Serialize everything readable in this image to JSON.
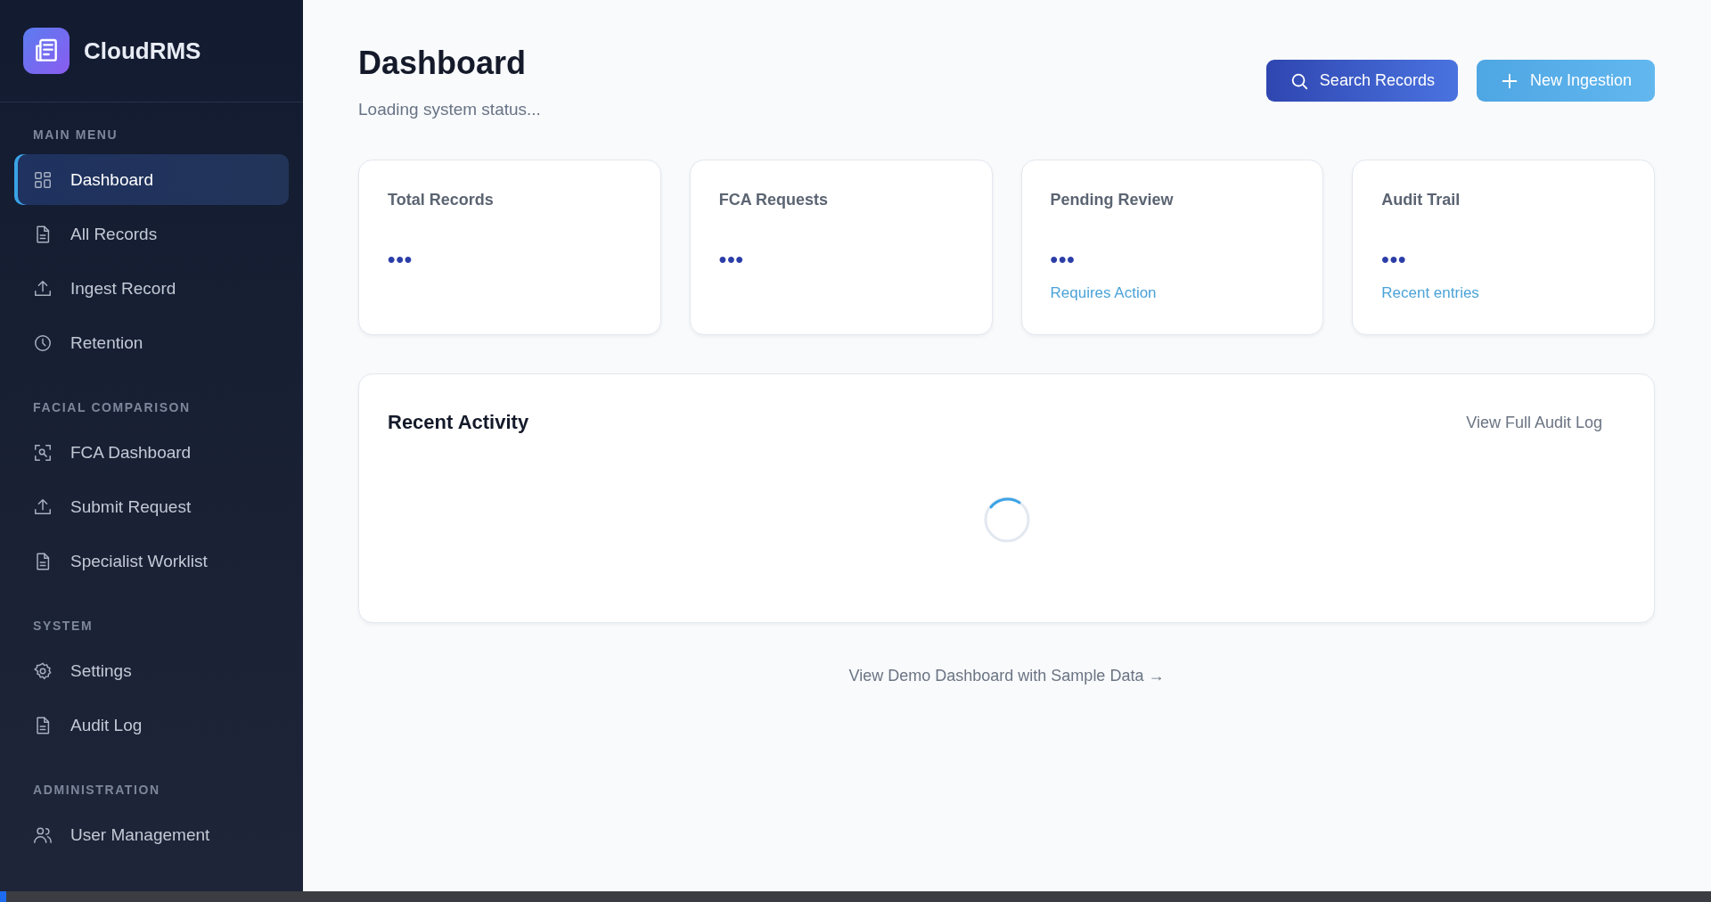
{
  "brand": {
    "name": "CloudRMS"
  },
  "sidebar": {
    "sections": [
      {
        "title": "MAIN MENU",
        "items": [
          {
            "label": "Dashboard",
            "selected": true
          },
          {
            "label": "All Records",
            "selected": false
          },
          {
            "label": "Ingest Record",
            "selected": false
          },
          {
            "label": "Retention",
            "selected": false
          }
        ]
      },
      {
        "title": "FACIAL COMPARISON",
        "items": [
          {
            "label": "FCA Dashboard",
            "selected": false
          },
          {
            "label": "Submit Request",
            "selected": false
          },
          {
            "label": "Specialist Worklist",
            "selected": false
          }
        ]
      },
      {
        "title": "SYSTEM",
        "items": [
          {
            "label": "Settings",
            "selected": false
          },
          {
            "label": "Audit Log",
            "selected": false
          }
        ]
      },
      {
        "title": "ADMINISTRATION",
        "items": [
          {
            "label": "User Management",
            "selected": false
          }
        ]
      }
    ]
  },
  "header": {
    "title": "Dashboard",
    "subtitle": "Loading system status...",
    "buttons": [
      {
        "label": "Search Records",
        "kind": "search"
      },
      {
        "label": "New Ingestion",
        "kind": "add"
      }
    ]
  },
  "stats": [
    {
      "label": "Total Records",
      "value": "•••"
    },
    {
      "label": "FCA Requests",
      "value": "•••"
    },
    {
      "label": "Pending Review",
      "value": "•••",
      "note": "Requires Action"
    },
    {
      "label": "Audit Trail",
      "value": "•••",
      "note": "Recent entries"
    }
  ],
  "recent_activity": {
    "title": "Recent Activity",
    "link": "View Full Audit Log"
  },
  "footer_link": "View Demo Dashboard with Sample Data →"
}
